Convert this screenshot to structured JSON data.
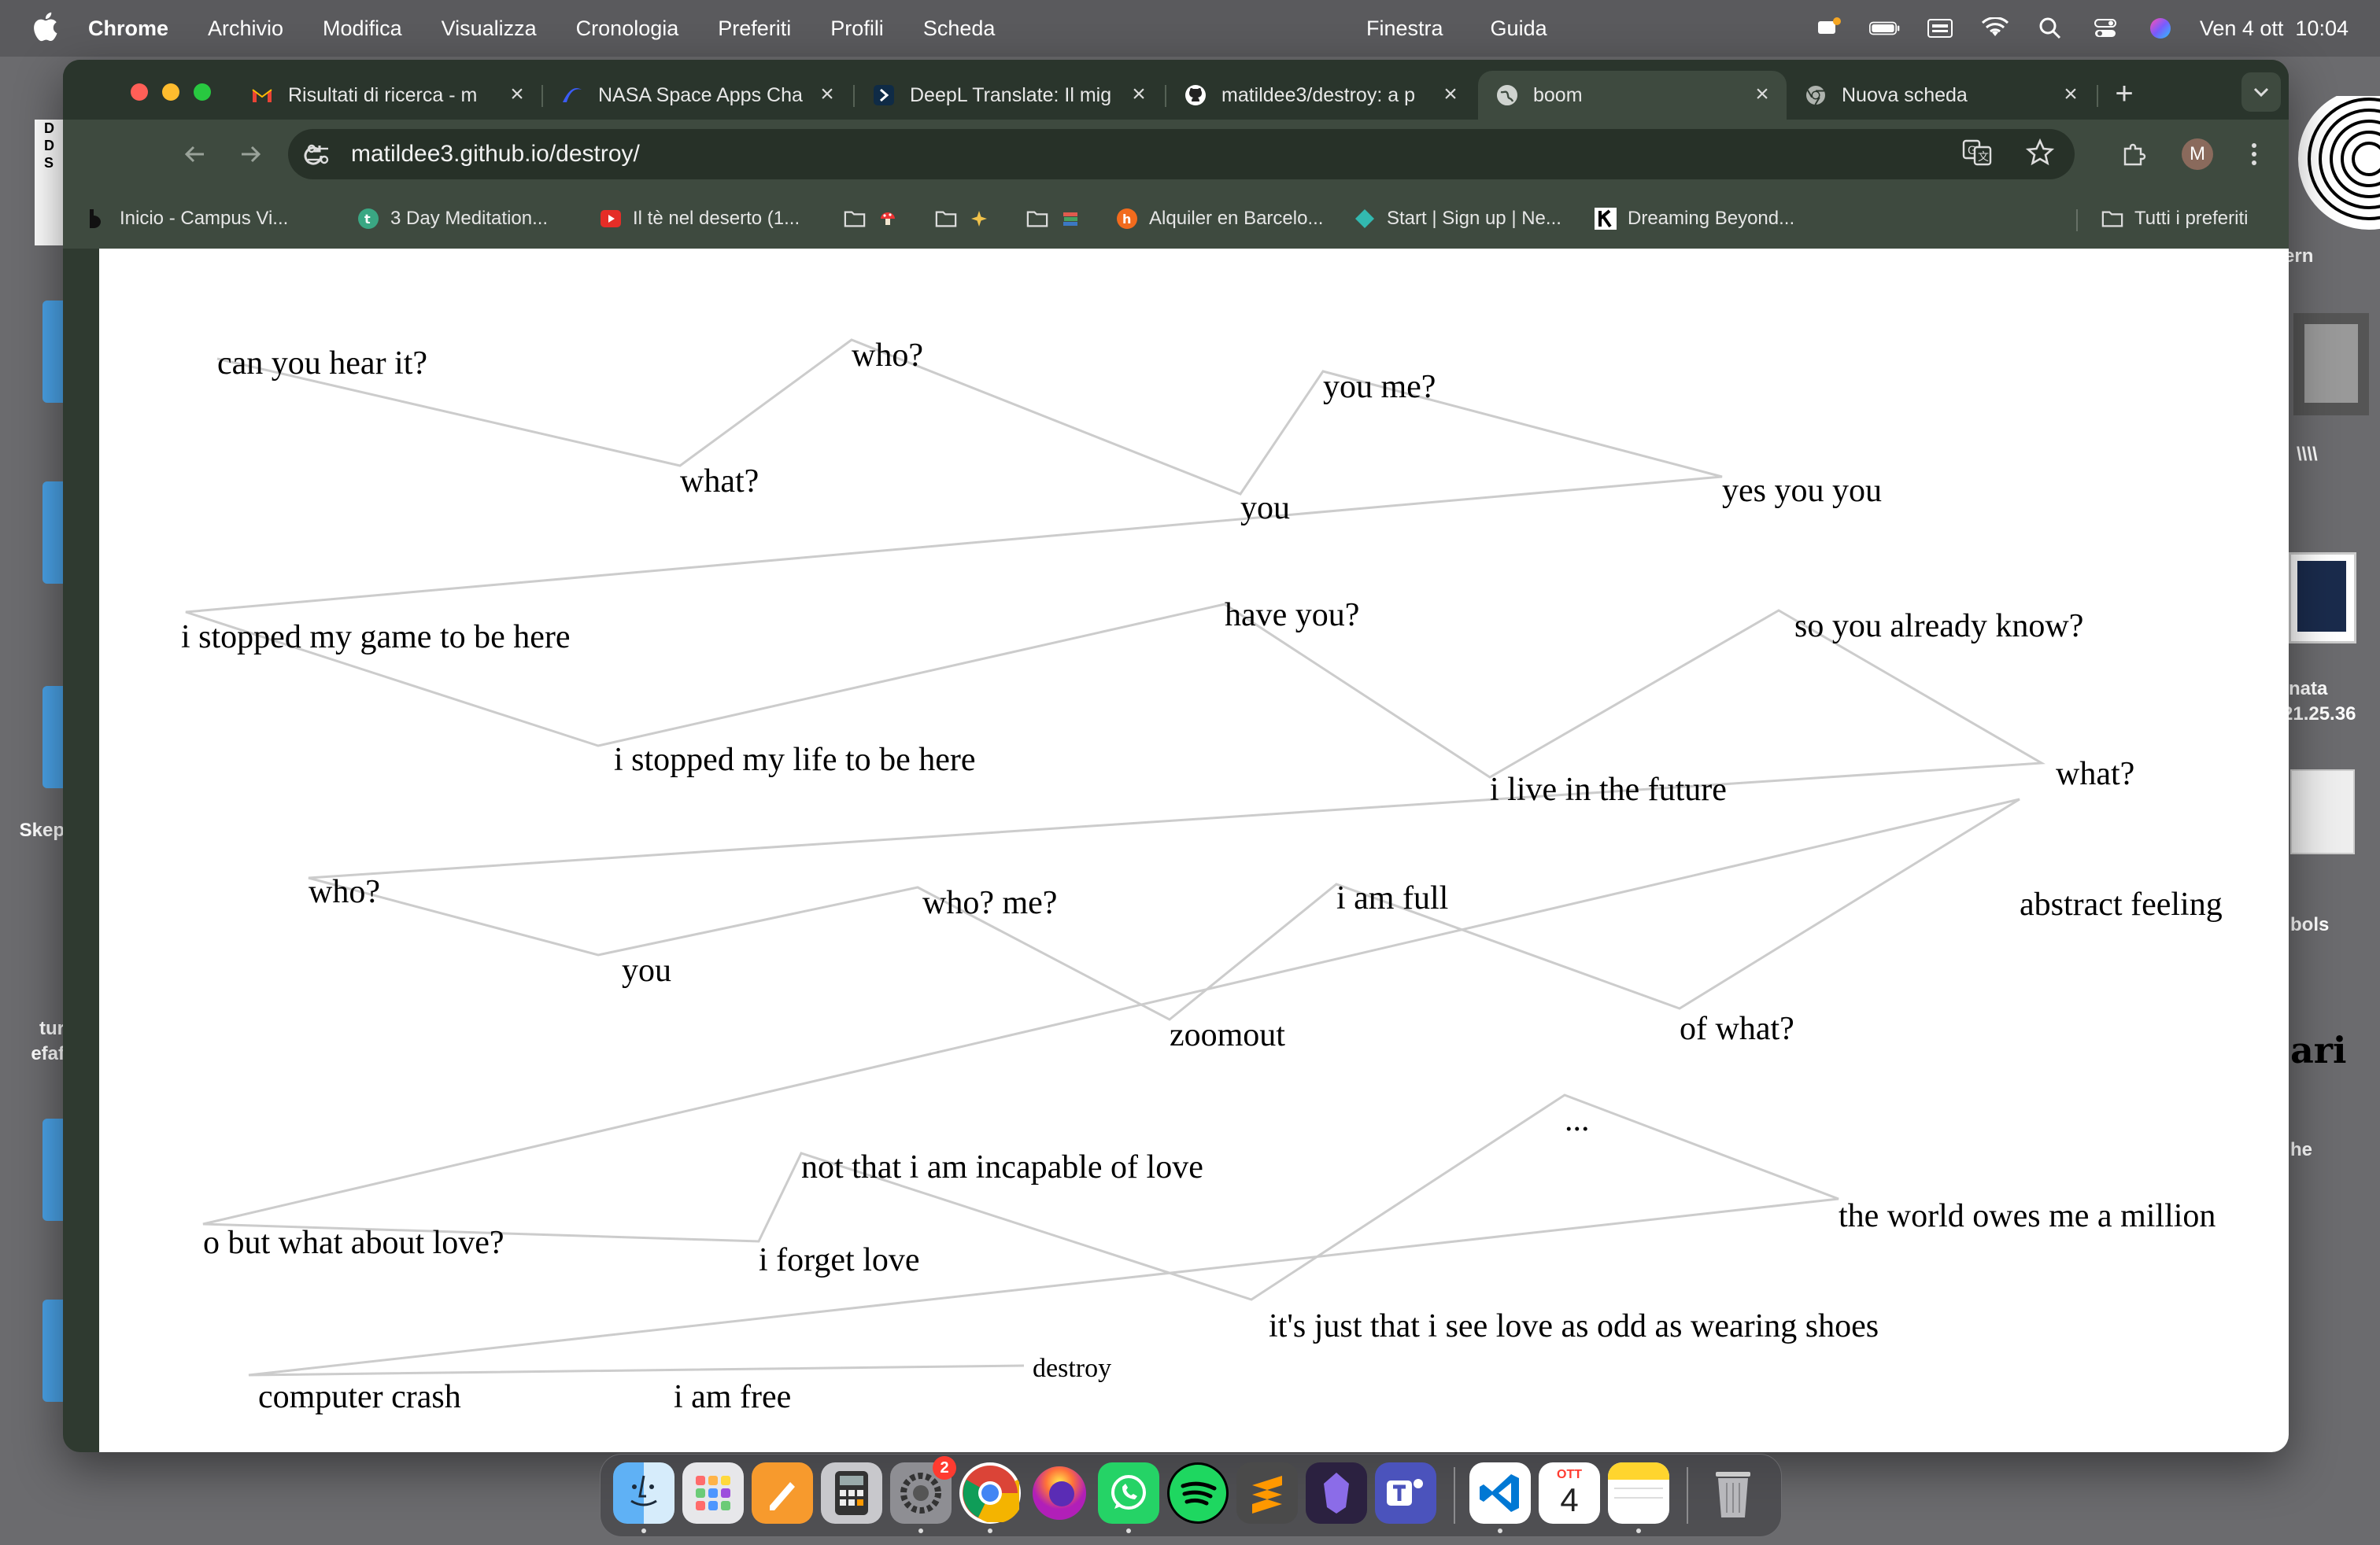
{
  "menubar": {
    "app_name": "Chrome",
    "items": [
      "Archivio",
      "Modifica",
      "Visualizza",
      "Cronologia",
      "Preferiti",
      "Profili",
      "Scheda"
    ],
    "items_mid": [
      "Finestra",
      "Guida"
    ],
    "datetime": "Ven 4 ott  10:04"
  },
  "desktop": {
    "left_labels": [
      "D",
      "D",
      "S",
      "Skep",
      "tur",
      "efaf"
    ],
    "right_labels": [
      "ern",
      "\\\\\\\\",
      "nata",
      "21.25.36",
      "bols",
      "ari",
      "he"
    ]
  },
  "tabs": [
    {
      "title": "Risultati di ricerca - m",
      "icon": "gmail-icon"
    },
    {
      "title": "NASA Space Apps Cha",
      "icon": "nasa-icon"
    },
    {
      "title": "DeepL Translate: Il mig",
      "icon": "deepl-icon"
    },
    {
      "title": "matildee3/destroy: a p",
      "icon": "github-icon"
    },
    {
      "title": "boom",
      "icon": "globe-icon"
    },
    {
      "title": "Nuova scheda",
      "icon": "chrome-icon"
    }
  ],
  "address_bar": {
    "url": "matildee3.github.io/destroy/"
  },
  "profile": {
    "initial": "M"
  },
  "bookmarks": [
    {
      "label": "Inicio - Campus Vi...",
      "icon": "campus-icon"
    },
    {
      "label": "3 Day Meditation...",
      "icon": "meditation-icon"
    },
    {
      "label": "Il tè nel deserto (1...",
      "icon": "youtube-icon"
    },
    {
      "label": "",
      "icon": "folder-icon"
    },
    {
      "label": "",
      "icon": "folder-icon"
    },
    {
      "label": "",
      "icon": "folder-icon"
    },
    {
      "label": "Alquiler en Barcelo...",
      "icon": "housing-icon"
    },
    {
      "label": "Start | Sign up | Ne...",
      "icon": "netlify-icon"
    },
    {
      "label": "Dreaming Beyond...",
      "icon": "k-icon"
    }
  ],
  "bookmarks_all": "Tutti i preferiti",
  "poem": {
    "words": [
      "can you hear it?",
      "what?",
      "who?",
      "you",
      "you me?",
      "yes you you",
      "i stopped my game to be here",
      "i stopped my life to be here",
      "have you?",
      "i live in the future",
      "so you already know?",
      "what?",
      "who?",
      "you",
      "who? me?",
      "zoomout",
      "i am full",
      "of what?",
      "abstract feeling",
      "o but what about love?",
      "i forget love",
      "not that i am incapable of love",
      "it's just that i see love as odd as wearing shoes",
      "...",
      "the world owes me a million",
      "computer crash",
      "i am free",
      "destroy"
    ]
  },
  "dock": {
    "apps": [
      "finder-icon",
      "launchpad-icon",
      "pages-icon",
      "calculator-icon",
      "system-settings-icon",
      "chrome-icon",
      "firefox-icon",
      "whatsapp-icon",
      "spotify-icon",
      "sublime-icon",
      "obsidian-icon",
      "teams-icon",
      "vscode-icon",
      "calendar-icon",
      "notes-icon",
      "trash-icon"
    ],
    "settings_badge": "2",
    "calendar_month": "OTT",
    "calendar_day": "4"
  },
  "colors": {
    "chrome_frame": "#3e4a3f",
    "tabbar": "#2a352c",
    "link_line": "#cccccc"
  }
}
